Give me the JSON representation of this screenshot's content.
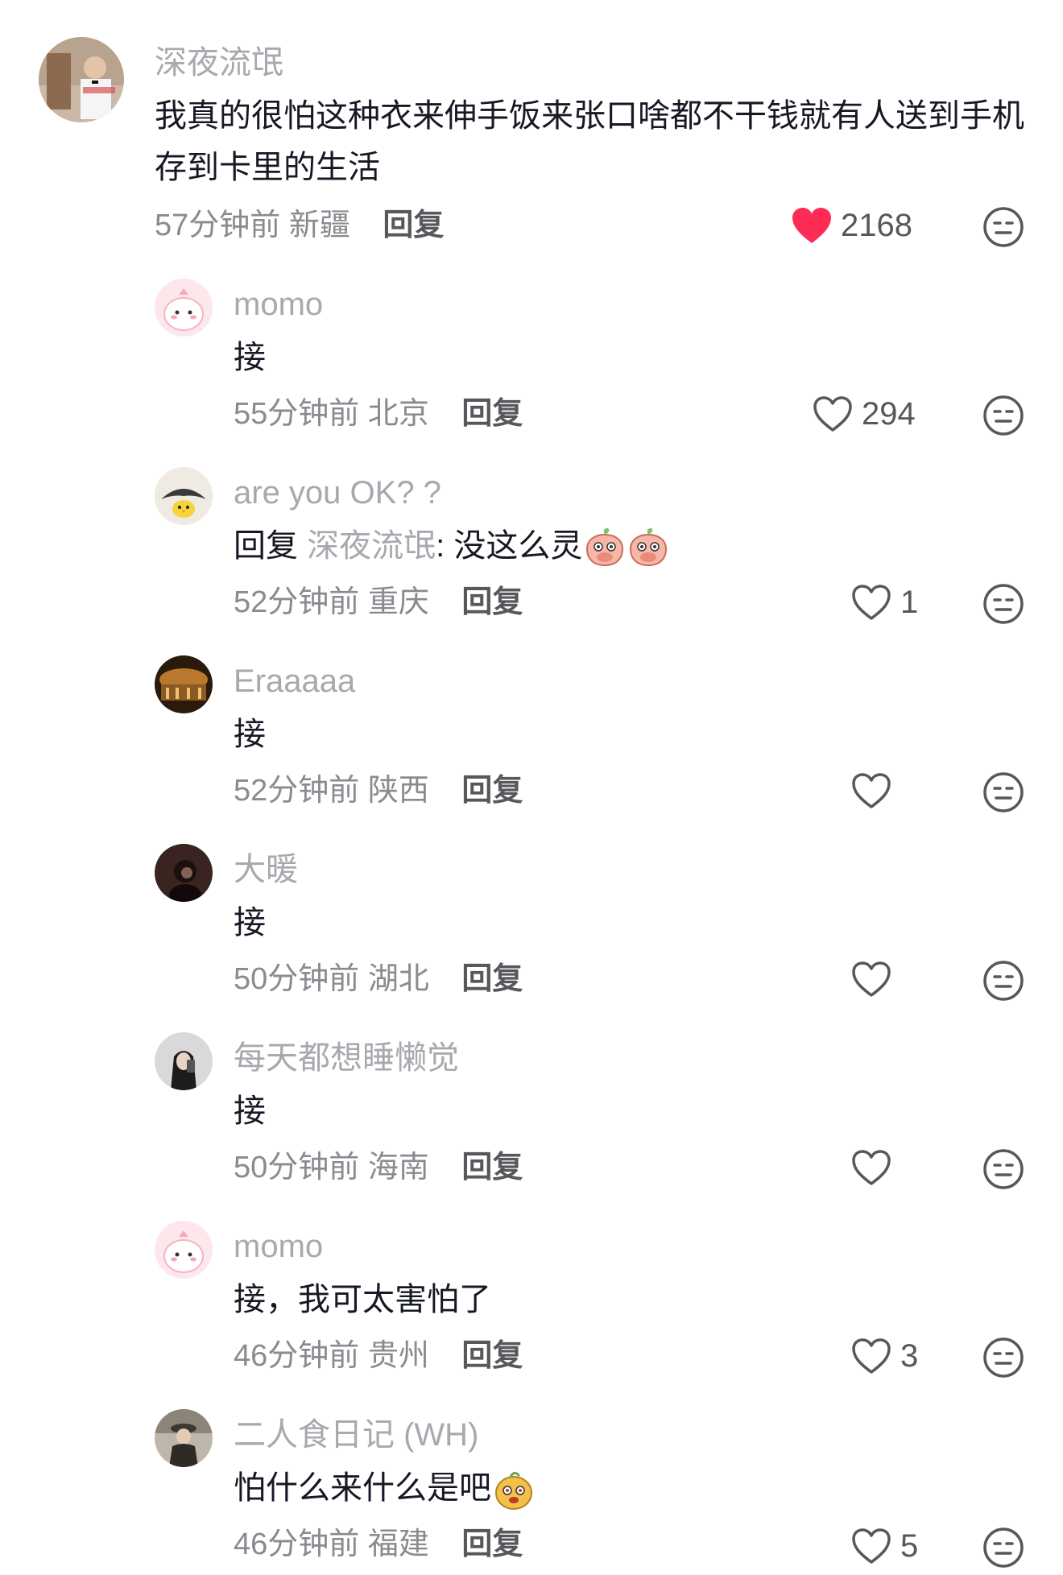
{
  "comments": [
    {
      "username": "深夜流氓",
      "text": "我真的很怕这种衣来伸手饭来张口啥都不干钱就有人送到手机存到卡里的生活",
      "time": "57分钟前",
      "location": "新疆",
      "reply_label": "回复",
      "likes": "2168",
      "liked": true
    },
    {
      "username": "momo",
      "text": "接",
      "time": "55分钟前",
      "location": "北京",
      "reply_label": "回复",
      "likes": "294",
      "liked": false
    },
    {
      "username": "are you OK? ?",
      "reply_prefix": "回复",
      "reply_target": "深夜流氓",
      "text": ": 没这么灵",
      "emojis": [
        "peach-cover-mouth-emoji",
        "peach-cover-mouth-emoji"
      ],
      "time": "52分钟前",
      "location": "重庆",
      "reply_label": "回复",
      "likes": "1",
      "liked": false
    },
    {
      "username": "Eraaaaa",
      "text": "接",
      "time": "52分钟前",
      "location": "陕西",
      "reply_label": "回复",
      "likes": "",
      "liked": false
    },
    {
      "username": "大暖",
      "text": "接",
      "time": "50分钟前",
      "location": "湖北",
      "reply_label": "回复",
      "likes": "",
      "liked": false
    },
    {
      "username": "每天都想睡懒觉",
      "text": "接",
      "time": "50分钟前",
      "location": "海南",
      "reply_label": "回复",
      "likes": "",
      "liked": false
    },
    {
      "username": "momo",
      "text": "接，我可太害怕了",
      "time": "46分钟前",
      "location": "贵州",
      "reply_label": "回复",
      "likes": "3",
      "liked": false
    },
    {
      "username": "二人食日记 (WH)",
      "text": "怕什么来什么是吧",
      "emojis": [
        "potato-face-emoji"
      ],
      "time": "46分钟前",
      "location": "福建",
      "reply_label": "回复",
      "likes": "5",
      "liked": false
    }
  ],
  "colors": {
    "liked_heart": "#fe2c55",
    "username": "#a8a8ae",
    "text": "#161823",
    "meta": "#8a8a90"
  }
}
